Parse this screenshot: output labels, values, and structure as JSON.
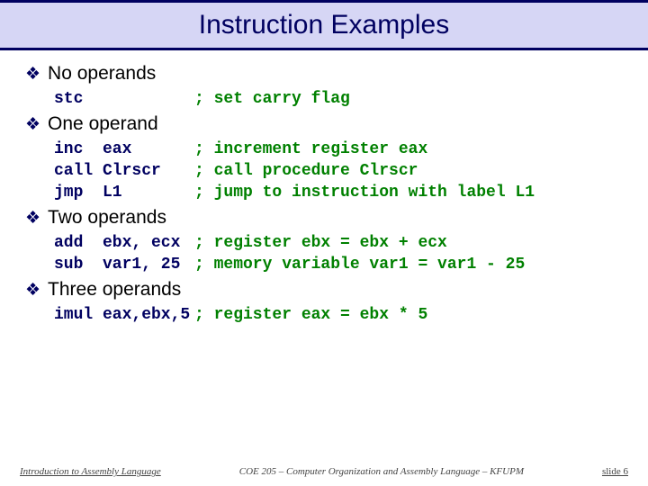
{
  "title": "Instruction Examples",
  "sections": [
    {
      "heading": "No operands",
      "lines": [
        {
          "op": "stc",
          "arg": "",
          "comment": "; set carry flag"
        }
      ]
    },
    {
      "heading": "One operand",
      "lines": [
        {
          "op": "inc",
          "arg": "eax",
          "comment": "; increment register eax"
        },
        {
          "op": "call",
          "arg": "Clrscr",
          "comment": "; call procedure Clrscr"
        },
        {
          "op": "jmp",
          "arg": "L1",
          "comment": "; jump to instruction with label L1"
        }
      ]
    },
    {
      "heading": "Two operands",
      "lines": [
        {
          "op": "add",
          "arg": "ebx, ecx",
          "comment": "; register ebx = ebx + ecx"
        },
        {
          "op": "sub",
          "arg": "var1, 25",
          "comment": "; memory variable var1 = var1 - 25"
        }
      ]
    },
    {
      "heading": "Three operands",
      "lines": [
        {
          "op": "imul",
          "arg": "eax,ebx,5",
          "comment": "; register eax = ebx * 5"
        }
      ]
    }
  ],
  "footer": {
    "left": "Introduction to Assembly Language",
    "center": "COE 205 – Computer Organization and Assembly Language – KFUPM",
    "right": "slide 6"
  }
}
